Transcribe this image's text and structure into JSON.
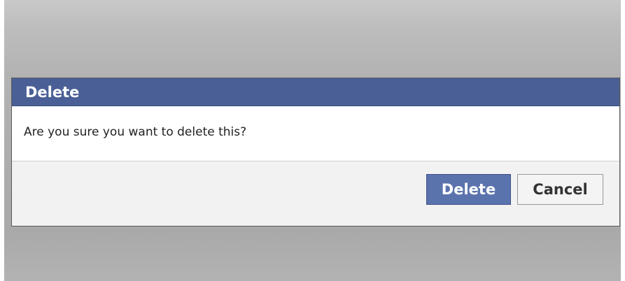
{
  "dialog": {
    "title": "Delete",
    "message": "Are you sure you want to delete this?",
    "buttons": {
      "confirm_label": "Delete",
      "cancel_label": "Cancel"
    }
  },
  "colors": {
    "header_background": "#4a5f95",
    "confirm_button": "#5b73ad",
    "cancel_button": "#f4f4f4",
    "footer_background": "#f2f2f2",
    "page_background": "#b2b2b2"
  }
}
